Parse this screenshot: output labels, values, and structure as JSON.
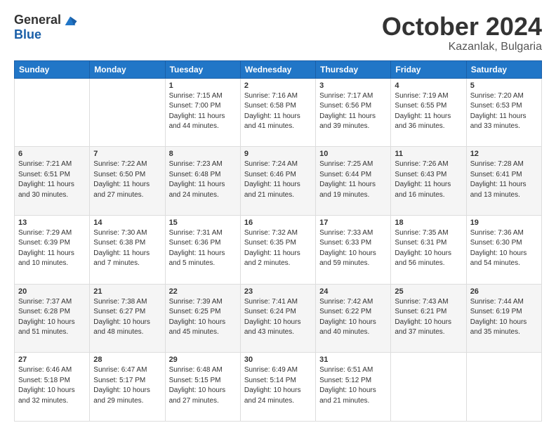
{
  "header": {
    "logo_general": "General",
    "logo_blue": "Blue",
    "month": "October 2024",
    "location": "Kazanlak, Bulgaria"
  },
  "days_of_week": [
    "Sunday",
    "Monday",
    "Tuesday",
    "Wednesday",
    "Thursday",
    "Friday",
    "Saturday"
  ],
  "weeks": [
    [
      {
        "day": "",
        "sunrise": "",
        "sunset": "",
        "daylight": ""
      },
      {
        "day": "",
        "sunrise": "",
        "sunset": "",
        "daylight": ""
      },
      {
        "day": "1",
        "sunrise": "Sunrise: 7:15 AM",
        "sunset": "Sunset: 7:00 PM",
        "daylight": "Daylight: 11 hours and 44 minutes."
      },
      {
        "day": "2",
        "sunrise": "Sunrise: 7:16 AM",
        "sunset": "Sunset: 6:58 PM",
        "daylight": "Daylight: 11 hours and 41 minutes."
      },
      {
        "day": "3",
        "sunrise": "Sunrise: 7:17 AM",
        "sunset": "Sunset: 6:56 PM",
        "daylight": "Daylight: 11 hours and 39 minutes."
      },
      {
        "day": "4",
        "sunrise": "Sunrise: 7:19 AM",
        "sunset": "Sunset: 6:55 PM",
        "daylight": "Daylight: 11 hours and 36 minutes."
      },
      {
        "day": "5",
        "sunrise": "Sunrise: 7:20 AM",
        "sunset": "Sunset: 6:53 PM",
        "daylight": "Daylight: 11 hours and 33 minutes."
      }
    ],
    [
      {
        "day": "6",
        "sunrise": "Sunrise: 7:21 AM",
        "sunset": "Sunset: 6:51 PM",
        "daylight": "Daylight: 11 hours and 30 minutes."
      },
      {
        "day": "7",
        "sunrise": "Sunrise: 7:22 AM",
        "sunset": "Sunset: 6:50 PM",
        "daylight": "Daylight: 11 hours and 27 minutes."
      },
      {
        "day": "8",
        "sunrise": "Sunrise: 7:23 AM",
        "sunset": "Sunset: 6:48 PM",
        "daylight": "Daylight: 11 hours and 24 minutes."
      },
      {
        "day": "9",
        "sunrise": "Sunrise: 7:24 AM",
        "sunset": "Sunset: 6:46 PM",
        "daylight": "Daylight: 11 hours and 21 minutes."
      },
      {
        "day": "10",
        "sunrise": "Sunrise: 7:25 AM",
        "sunset": "Sunset: 6:44 PM",
        "daylight": "Daylight: 11 hours and 19 minutes."
      },
      {
        "day": "11",
        "sunrise": "Sunrise: 7:26 AM",
        "sunset": "Sunset: 6:43 PM",
        "daylight": "Daylight: 11 hours and 16 minutes."
      },
      {
        "day": "12",
        "sunrise": "Sunrise: 7:28 AM",
        "sunset": "Sunset: 6:41 PM",
        "daylight": "Daylight: 11 hours and 13 minutes."
      }
    ],
    [
      {
        "day": "13",
        "sunrise": "Sunrise: 7:29 AM",
        "sunset": "Sunset: 6:39 PM",
        "daylight": "Daylight: 11 hours and 10 minutes."
      },
      {
        "day": "14",
        "sunrise": "Sunrise: 7:30 AM",
        "sunset": "Sunset: 6:38 PM",
        "daylight": "Daylight: 11 hours and 7 minutes."
      },
      {
        "day": "15",
        "sunrise": "Sunrise: 7:31 AM",
        "sunset": "Sunset: 6:36 PM",
        "daylight": "Daylight: 11 hours and 5 minutes."
      },
      {
        "day": "16",
        "sunrise": "Sunrise: 7:32 AM",
        "sunset": "Sunset: 6:35 PM",
        "daylight": "Daylight: 11 hours and 2 minutes."
      },
      {
        "day": "17",
        "sunrise": "Sunrise: 7:33 AM",
        "sunset": "Sunset: 6:33 PM",
        "daylight": "Daylight: 10 hours and 59 minutes."
      },
      {
        "day": "18",
        "sunrise": "Sunrise: 7:35 AM",
        "sunset": "Sunset: 6:31 PM",
        "daylight": "Daylight: 10 hours and 56 minutes."
      },
      {
        "day": "19",
        "sunrise": "Sunrise: 7:36 AM",
        "sunset": "Sunset: 6:30 PM",
        "daylight": "Daylight: 10 hours and 54 minutes."
      }
    ],
    [
      {
        "day": "20",
        "sunrise": "Sunrise: 7:37 AM",
        "sunset": "Sunset: 6:28 PM",
        "daylight": "Daylight: 10 hours and 51 minutes."
      },
      {
        "day": "21",
        "sunrise": "Sunrise: 7:38 AM",
        "sunset": "Sunset: 6:27 PM",
        "daylight": "Daylight: 10 hours and 48 minutes."
      },
      {
        "day": "22",
        "sunrise": "Sunrise: 7:39 AM",
        "sunset": "Sunset: 6:25 PM",
        "daylight": "Daylight: 10 hours and 45 minutes."
      },
      {
        "day": "23",
        "sunrise": "Sunrise: 7:41 AM",
        "sunset": "Sunset: 6:24 PM",
        "daylight": "Daylight: 10 hours and 43 minutes."
      },
      {
        "day": "24",
        "sunrise": "Sunrise: 7:42 AM",
        "sunset": "Sunset: 6:22 PM",
        "daylight": "Daylight: 10 hours and 40 minutes."
      },
      {
        "day": "25",
        "sunrise": "Sunrise: 7:43 AM",
        "sunset": "Sunset: 6:21 PM",
        "daylight": "Daylight: 10 hours and 37 minutes."
      },
      {
        "day": "26",
        "sunrise": "Sunrise: 7:44 AM",
        "sunset": "Sunset: 6:19 PM",
        "daylight": "Daylight: 10 hours and 35 minutes."
      }
    ],
    [
      {
        "day": "27",
        "sunrise": "Sunrise: 6:46 AM",
        "sunset": "Sunset: 5:18 PM",
        "daylight": "Daylight: 10 hours and 32 minutes."
      },
      {
        "day": "28",
        "sunrise": "Sunrise: 6:47 AM",
        "sunset": "Sunset: 5:17 PM",
        "daylight": "Daylight: 10 hours and 29 minutes."
      },
      {
        "day": "29",
        "sunrise": "Sunrise: 6:48 AM",
        "sunset": "Sunset: 5:15 PM",
        "daylight": "Daylight: 10 hours and 27 minutes."
      },
      {
        "day": "30",
        "sunrise": "Sunrise: 6:49 AM",
        "sunset": "Sunset: 5:14 PM",
        "daylight": "Daylight: 10 hours and 24 minutes."
      },
      {
        "day": "31",
        "sunrise": "Sunrise: 6:51 AM",
        "sunset": "Sunset: 5:12 PM",
        "daylight": "Daylight: 10 hours and 21 minutes."
      },
      {
        "day": "",
        "sunrise": "",
        "sunset": "",
        "daylight": ""
      },
      {
        "day": "",
        "sunrise": "",
        "sunset": "",
        "daylight": ""
      }
    ]
  ]
}
